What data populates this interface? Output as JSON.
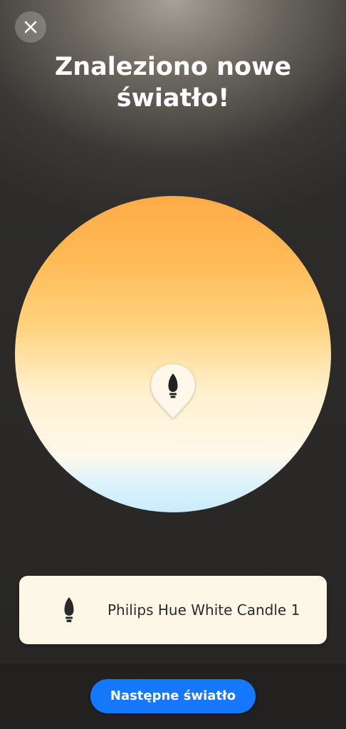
{
  "header": {
    "close_icon": "close-icon",
    "title_line1": "Znaleziono nowe",
    "title_line2": "światło!"
  },
  "color_wheel": {
    "type": "white-ambiance-temperature",
    "top_color": "#ffab47",
    "middle_color": "#fff1cf",
    "bottom_color": "#c8ecfd",
    "selector_icon": "candle-bulb-icon"
  },
  "light_card": {
    "icon": "candle-bulb-icon",
    "name": "Philips Hue White Candle 1"
  },
  "footer": {
    "next_button_label": "Następne światło"
  },
  "colors": {
    "accent": "#1677ff",
    "card_background": "#fdf7e7"
  }
}
